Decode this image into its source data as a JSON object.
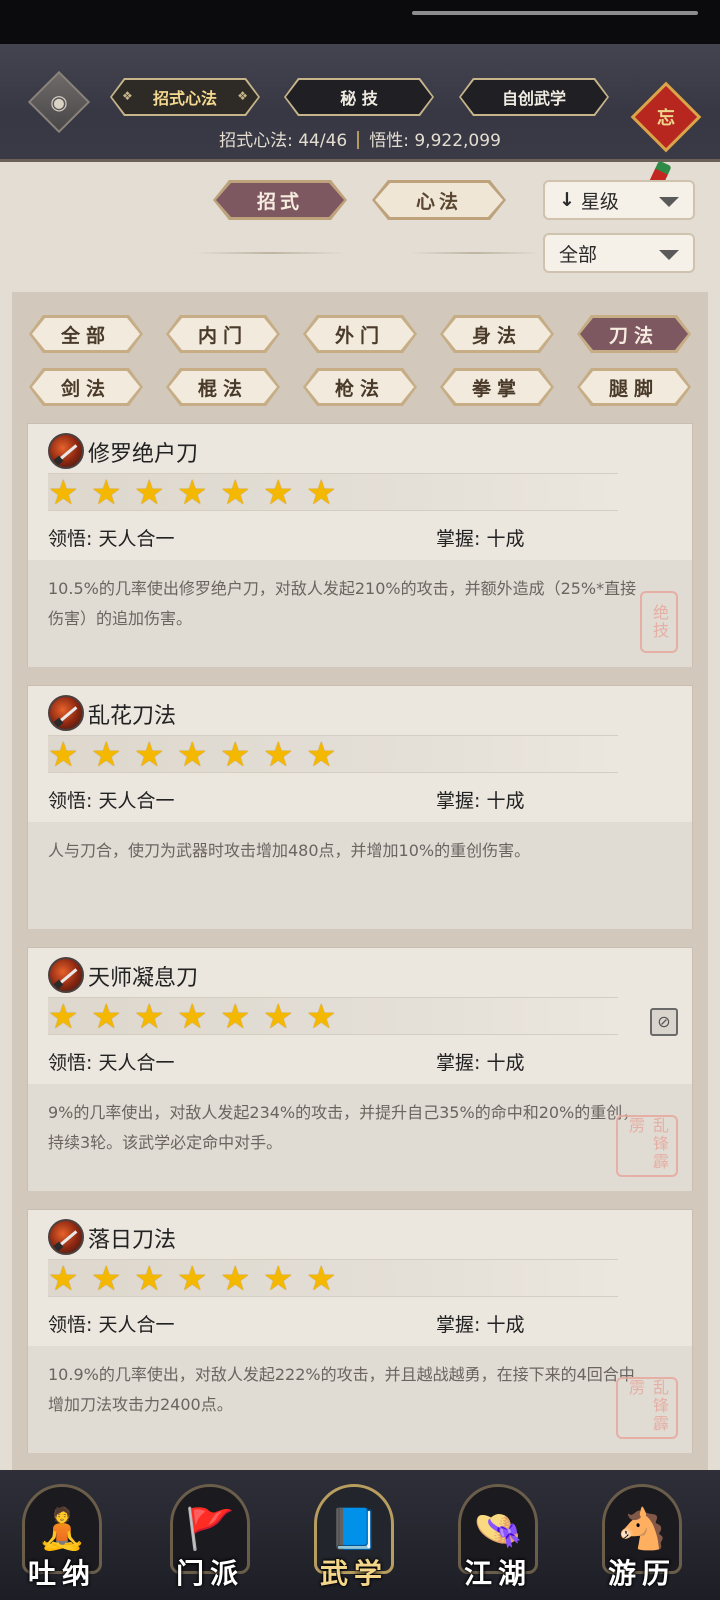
{
  "header": {
    "tabs": [
      {
        "label": "招式心法",
        "active": true
      },
      {
        "label": "秘 技",
        "active": false
      },
      {
        "label": "自创武学",
        "active": false
      }
    ],
    "stats_label_left": "招式心法: 44/46",
    "stats_label_right": "悟性: 9,922,099",
    "knot_char": "忘",
    "eye_icon": "eye-icon"
  },
  "subtabs": [
    {
      "label": "招式",
      "active": true
    },
    {
      "label": "心法",
      "active": false
    }
  ],
  "sort_dropdown": {
    "arrow": "↓",
    "value": "星级"
  },
  "filter_dropdown": {
    "value": "全部"
  },
  "categories": [
    {
      "label": "全部",
      "active": false
    },
    {
      "label": "内门",
      "active": false
    },
    {
      "label": "外门",
      "active": false
    },
    {
      "label": "身法",
      "active": false
    },
    {
      "label": "刀法",
      "active": true
    },
    {
      "label": "剑法",
      "active": false
    },
    {
      "label": "棍法",
      "active": false
    },
    {
      "label": "枪法",
      "active": false
    },
    {
      "label": "拳掌",
      "active": false
    },
    {
      "label": "腿脚",
      "active": false
    }
  ],
  "skills": [
    {
      "name": "修罗绝户刀",
      "stars": 7,
      "comprehension": "领悟: 天人合一",
      "mastery": "掌握: 十成",
      "description": "10.5%的几率使出修罗绝户刀，对敌人发起210%的攻击，并额外造成（25%*直接伤害）的追加伤害。",
      "seal": "绝技"
    },
    {
      "name": "乱花刀法",
      "stars": 7,
      "comprehension": "领悟: 天人合一",
      "mastery": "掌握: 十成",
      "description": "人与刀合，使刀为武器时攻击增加480点，并增加10%的重创伤害。",
      "seal": ""
    },
    {
      "name": "天师凝息刀",
      "stars": 7,
      "comprehension": "领悟: 天人合一",
      "mastery": "掌握: 十成",
      "description": "9%的几率使出，对敌人发起234%的攻击，并提升自己35%的命中和20%的重创，持续3轮。该武学必定命中对手。",
      "seal": "乱锋霹雳"
    },
    {
      "name": "落日刀法",
      "stars": 7,
      "comprehension": "领悟: 天人合一",
      "mastery": "掌握: 十成",
      "description": "10.9%的几率使出，对敌人发起222%的攻击，并且越战越勇，在接下来的4回合中增加刀法攻击力2400点。",
      "seal": "乱锋霹雳"
    }
  ],
  "bottom_nav": [
    {
      "label": "吐纳",
      "icon": "monk-icon",
      "active": false
    },
    {
      "label": "门派",
      "icon": "banner-icon",
      "active": false
    },
    {
      "label": "武学",
      "icon": "book-icon",
      "active": true
    },
    {
      "label": "江湖",
      "icon": "hat-icon",
      "active": false
    },
    {
      "label": "游历",
      "icon": "horse-icon",
      "active": false
    }
  ]
}
